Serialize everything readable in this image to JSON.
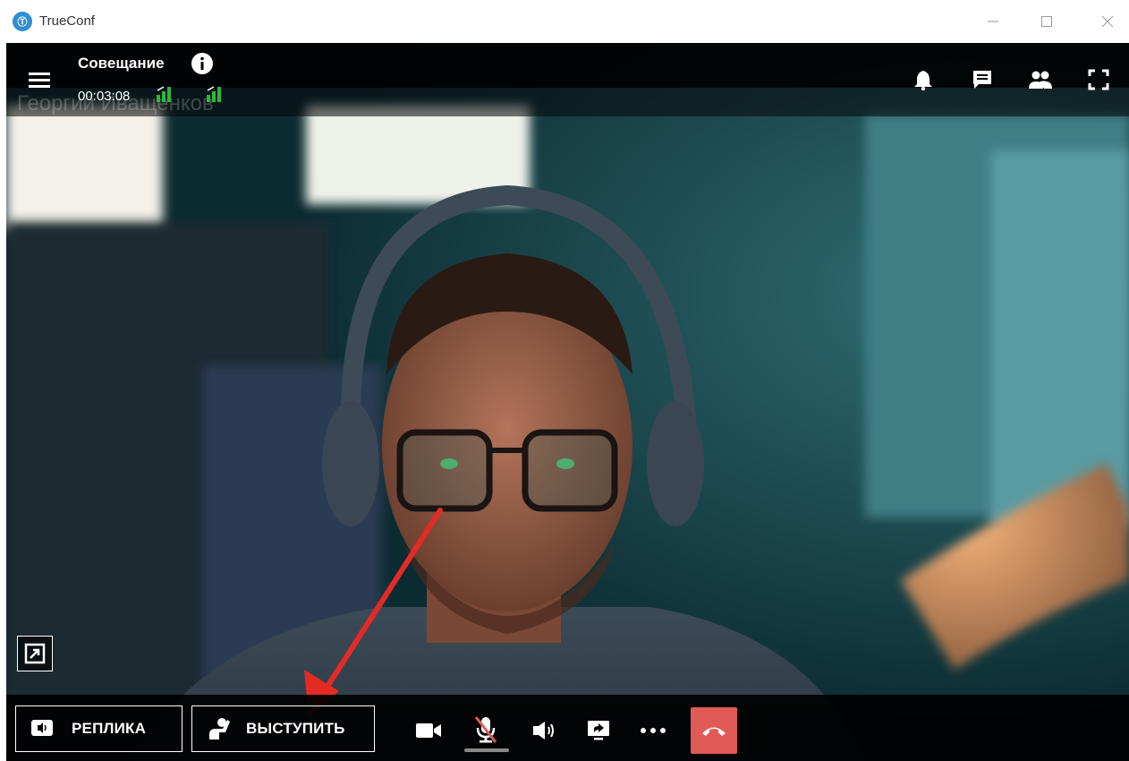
{
  "app": {
    "title": "TrueConf",
    "logo_glyph": "Ⓣ"
  },
  "conference": {
    "title": "Совещание",
    "timer": "00:03:08",
    "participant_name": "Георгий Иващенков"
  },
  "toolbar": {
    "reply_label": "РЕПЛИКА",
    "speak_label": "ВЫСТУПИТЬ"
  },
  "colors": {
    "signal_green": "#2db83d",
    "hangup_red": "#e05a56",
    "arrow_red": "#e42a25"
  },
  "icons": [
    "menu-icon",
    "info-icon",
    "signal-icon",
    "bell-icon",
    "chat-icon",
    "participants-icon",
    "fullscreen-icon",
    "expand-icon",
    "reply-icon",
    "raise-hand-icon",
    "camera-icon",
    "microphone-muted-icon",
    "speaker-icon",
    "screen-share-icon",
    "more-icon",
    "hangup-icon"
  ]
}
